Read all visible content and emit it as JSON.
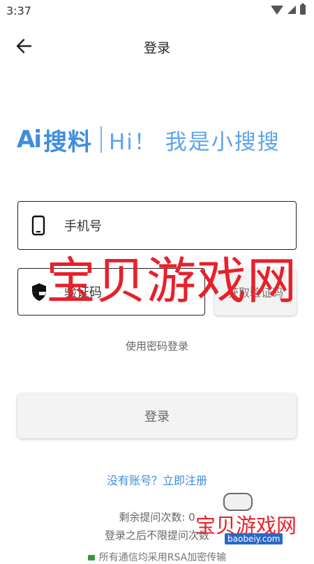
{
  "status_bar": {
    "time": "3:37"
  },
  "header": {
    "title": "登录"
  },
  "brand": {
    "logo_text": "Ai",
    "name": "搜料",
    "slogan": "Hi！ 我是小搜搜"
  },
  "form": {
    "phone_placeholder": "手机号",
    "code_placeholder": "验证码",
    "get_code_label": "获取验证码",
    "password_login_label": "使用密码登录",
    "login_button_label": "登录"
  },
  "register_link": "没有账号？立即注册",
  "footer": {
    "remaining_text": "剩余提问次数: 0",
    "unlimited_text": "登录之后不限提问次数",
    "encrypt_text": "所有通信均采用RSA加密传输"
  },
  "watermark": {
    "big_text": "宝贝游戏网",
    "small_text": "宝贝游戏网",
    "url": "baobeiy.com"
  },
  "colors": {
    "accent": "#3f8de0",
    "watermark": "#e8202a"
  },
  "icons": [
    "back-arrow-icon",
    "phone-icon",
    "shield-icon",
    "lock-icon",
    "wifi-icon",
    "signal-icon",
    "battery-icon"
  ]
}
